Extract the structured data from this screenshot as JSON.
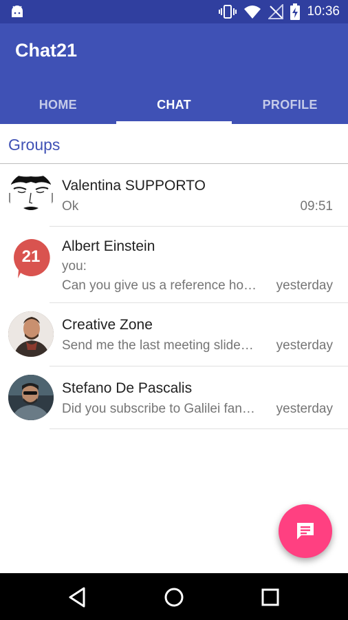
{
  "status_bar": {
    "time": "10:36",
    "icons": [
      "android-icon",
      "vibrate-icon",
      "wifi-icon",
      "no-signal-icon",
      "battery-charging-icon"
    ]
  },
  "app_bar": {
    "title": "Chat21",
    "tabs": [
      {
        "label": "HOME",
        "active": false
      },
      {
        "label": "CHAT",
        "active": true
      },
      {
        "label": "PROFILE",
        "active": false
      }
    ]
  },
  "section": {
    "title": "Groups"
  },
  "conversations": [
    {
      "name": "Valentina SUPPORTO",
      "message": "Ok",
      "time": "09:51",
      "avatar": "sketch-face-avatar"
    },
    {
      "name": "Albert Einstein",
      "message_prefix": "you:",
      "message": "Can you give us a reference ho…",
      "time": "yesterday",
      "avatar": "chat21-logo-avatar",
      "avatar_text": "21"
    },
    {
      "name": "Creative Zone",
      "message": "Send me the last meeting slide…",
      "time": "yesterday",
      "avatar": "photo-avatar"
    },
    {
      "name": "Stefano De Pascalis",
      "message": "Did you subscribe to Galilei fan…",
      "time": "yesterday",
      "avatar": "photo-avatar"
    }
  ],
  "fab": {
    "icon": "message-icon"
  },
  "nav_bar": {
    "icons": [
      "back-icon",
      "home-icon",
      "recents-icon"
    ]
  },
  "colors": {
    "primary": "#3f51b5",
    "primary_dark": "#303f9f",
    "accent": "#ff4081",
    "logo_red": "#d9534f"
  }
}
